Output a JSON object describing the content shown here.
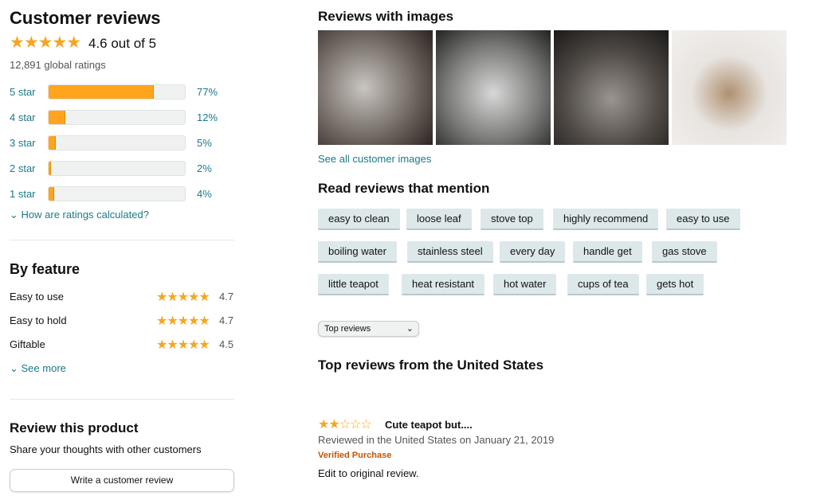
{
  "summary": {
    "title": "Customer reviews",
    "stars": "★★★★★",
    "rating_text": "4.6 out of 5",
    "global_ratings": "12,891 global ratings"
  },
  "histogram": [
    {
      "label": "5 star",
      "percent": 77,
      "pct_text": "77%"
    },
    {
      "label": "4 star",
      "percent": 12,
      "pct_text": "12%"
    },
    {
      "label": "3 star",
      "percent": 5,
      "pct_text": "5%"
    },
    {
      "label": "2 star",
      "percent": 2,
      "pct_text": "2%"
    },
    {
      "label": "1 star",
      "percent": 4,
      "pct_text": "4%"
    }
  ],
  "how_calculated": "How are ratings calculated?",
  "by_feature": {
    "title": "By feature",
    "items": [
      {
        "name": "Easy to use",
        "stars": "★★★★★",
        "value": "4.7"
      },
      {
        "name": "Easy to hold",
        "stars": "★★★★★",
        "value": "4.7"
      },
      {
        "name": "Giftable",
        "stars": "★★★★★",
        "value": "4.5"
      }
    ],
    "see_more": "See more"
  },
  "review_product": {
    "title": "Review this product",
    "subtitle": "Share your thoughts with other customers",
    "button": "Write a customer review"
  },
  "images": {
    "title": "Reviews with images",
    "see_all": "See all customer images"
  },
  "mentions": {
    "title": "Read reviews that mention",
    "chips": [
      [
        "easy to clean",
        "loose leaf",
        "stove top",
        "highly recommend",
        "easy to use"
      ],
      [
        "boiling water",
        "stainless steel",
        "every day",
        "handle get",
        "gas stove"
      ],
      [
        "little teapot",
        "heat resistant",
        "hot water",
        "cups of tea",
        "gets hot"
      ]
    ]
  },
  "sort": {
    "selected": "Top reviews"
  },
  "top_reviews": {
    "title": "Top reviews from the United States"
  },
  "review": {
    "stars_filled": "★★",
    "stars_empty": "☆☆☆",
    "rating": 2,
    "title": "Cute teapot but....",
    "meta": "Reviewed in the United States on January 21, 2019",
    "verified": "Verified Purchase",
    "body": "Edit to original review."
  },
  "colors": {
    "star": "#f5a623",
    "bar": "#ffa41c",
    "link": "#1a7a8a",
    "verified": "#c45500"
  }
}
